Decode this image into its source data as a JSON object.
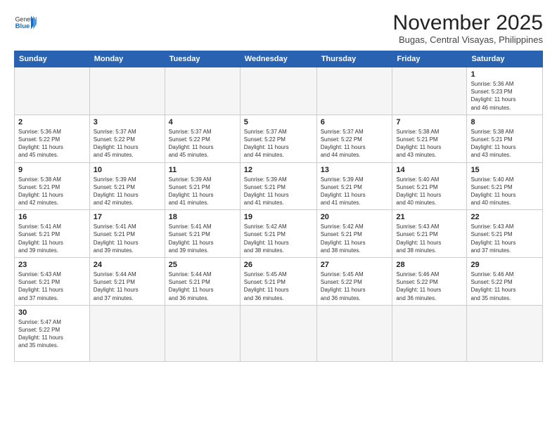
{
  "header": {
    "logo_general": "General",
    "logo_blue": "Blue",
    "title": "November 2025",
    "subtitle": "Bugas, Central Visayas, Philippines"
  },
  "weekdays": [
    "Sunday",
    "Monday",
    "Tuesday",
    "Wednesday",
    "Thursday",
    "Friday",
    "Saturday"
  ],
  "weeks": [
    [
      {
        "day": "",
        "info": ""
      },
      {
        "day": "",
        "info": ""
      },
      {
        "day": "",
        "info": ""
      },
      {
        "day": "",
        "info": ""
      },
      {
        "day": "",
        "info": ""
      },
      {
        "day": "",
        "info": ""
      },
      {
        "day": "1",
        "info": "Sunrise: 5:36 AM\nSunset: 5:23 PM\nDaylight: 11 hours\nand 46 minutes."
      }
    ],
    [
      {
        "day": "2",
        "info": "Sunrise: 5:36 AM\nSunset: 5:22 PM\nDaylight: 11 hours\nand 45 minutes."
      },
      {
        "day": "3",
        "info": "Sunrise: 5:37 AM\nSunset: 5:22 PM\nDaylight: 11 hours\nand 45 minutes."
      },
      {
        "day": "4",
        "info": "Sunrise: 5:37 AM\nSunset: 5:22 PM\nDaylight: 11 hours\nand 45 minutes."
      },
      {
        "day": "5",
        "info": "Sunrise: 5:37 AM\nSunset: 5:22 PM\nDaylight: 11 hours\nand 44 minutes."
      },
      {
        "day": "6",
        "info": "Sunrise: 5:37 AM\nSunset: 5:22 PM\nDaylight: 11 hours\nand 44 minutes."
      },
      {
        "day": "7",
        "info": "Sunrise: 5:38 AM\nSunset: 5:21 PM\nDaylight: 11 hours\nand 43 minutes."
      },
      {
        "day": "8",
        "info": "Sunrise: 5:38 AM\nSunset: 5:21 PM\nDaylight: 11 hours\nand 43 minutes."
      }
    ],
    [
      {
        "day": "9",
        "info": "Sunrise: 5:38 AM\nSunset: 5:21 PM\nDaylight: 11 hours\nand 42 minutes."
      },
      {
        "day": "10",
        "info": "Sunrise: 5:39 AM\nSunset: 5:21 PM\nDaylight: 11 hours\nand 42 minutes."
      },
      {
        "day": "11",
        "info": "Sunrise: 5:39 AM\nSunset: 5:21 PM\nDaylight: 11 hours\nand 41 minutes."
      },
      {
        "day": "12",
        "info": "Sunrise: 5:39 AM\nSunset: 5:21 PM\nDaylight: 11 hours\nand 41 minutes."
      },
      {
        "day": "13",
        "info": "Sunrise: 5:39 AM\nSunset: 5:21 PM\nDaylight: 11 hours\nand 41 minutes."
      },
      {
        "day": "14",
        "info": "Sunrise: 5:40 AM\nSunset: 5:21 PM\nDaylight: 11 hours\nand 40 minutes."
      },
      {
        "day": "15",
        "info": "Sunrise: 5:40 AM\nSunset: 5:21 PM\nDaylight: 11 hours\nand 40 minutes."
      }
    ],
    [
      {
        "day": "16",
        "info": "Sunrise: 5:41 AM\nSunset: 5:21 PM\nDaylight: 11 hours\nand 39 minutes."
      },
      {
        "day": "17",
        "info": "Sunrise: 5:41 AM\nSunset: 5:21 PM\nDaylight: 11 hours\nand 39 minutes."
      },
      {
        "day": "18",
        "info": "Sunrise: 5:41 AM\nSunset: 5:21 PM\nDaylight: 11 hours\nand 39 minutes."
      },
      {
        "day": "19",
        "info": "Sunrise: 5:42 AM\nSunset: 5:21 PM\nDaylight: 11 hours\nand 38 minutes."
      },
      {
        "day": "20",
        "info": "Sunrise: 5:42 AM\nSunset: 5:21 PM\nDaylight: 11 hours\nand 38 minutes."
      },
      {
        "day": "21",
        "info": "Sunrise: 5:43 AM\nSunset: 5:21 PM\nDaylight: 11 hours\nand 38 minutes."
      },
      {
        "day": "22",
        "info": "Sunrise: 5:43 AM\nSunset: 5:21 PM\nDaylight: 11 hours\nand 37 minutes."
      }
    ],
    [
      {
        "day": "23",
        "info": "Sunrise: 5:43 AM\nSunset: 5:21 PM\nDaylight: 11 hours\nand 37 minutes."
      },
      {
        "day": "24",
        "info": "Sunrise: 5:44 AM\nSunset: 5:21 PM\nDaylight: 11 hours\nand 37 minutes."
      },
      {
        "day": "25",
        "info": "Sunrise: 5:44 AM\nSunset: 5:21 PM\nDaylight: 11 hours\nand 36 minutes."
      },
      {
        "day": "26",
        "info": "Sunrise: 5:45 AM\nSunset: 5:21 PM\nDaylight: 11 hours\nand 36 minutes."
      },
      {
        "day": "27",
        "info": "Sunrise: 5:45 AM\nSunset: 5:22 PM\nDaylight: 11 hours\nand 36 minutes."
      },
      {
        "day": "28",
        "info": "Sunrise: 5:46 AM\nSunset: 5:22 PM\nDaylight: 11 hours\nand 36 minutes."
      },
      {
        "day": "29",
        "info": "Sunrise: 5:46 AM\nSunset: 5:22 PM\nDaylight: 11 hours\nand 35 minutes."
      }
    ],
    [
      {
        "day": "30",
        "info": "Sunrise: 5:47 AM\nSunset: 5:22 PM\nDaylight: 11 hours\nand 35 minutes."
      },
      {
        "day": "",
        "info": ""
      },
      {
        "day": "",
        "info": ""
      },
      {
        "day": "",
        "info": ""
      },
      {
        "day": "",
        "info": ""
      },
      {
        "day": "",
        "info": ""
      },
      {
        "day": "",
        "info": ""
      }
    ]
  ]
}
